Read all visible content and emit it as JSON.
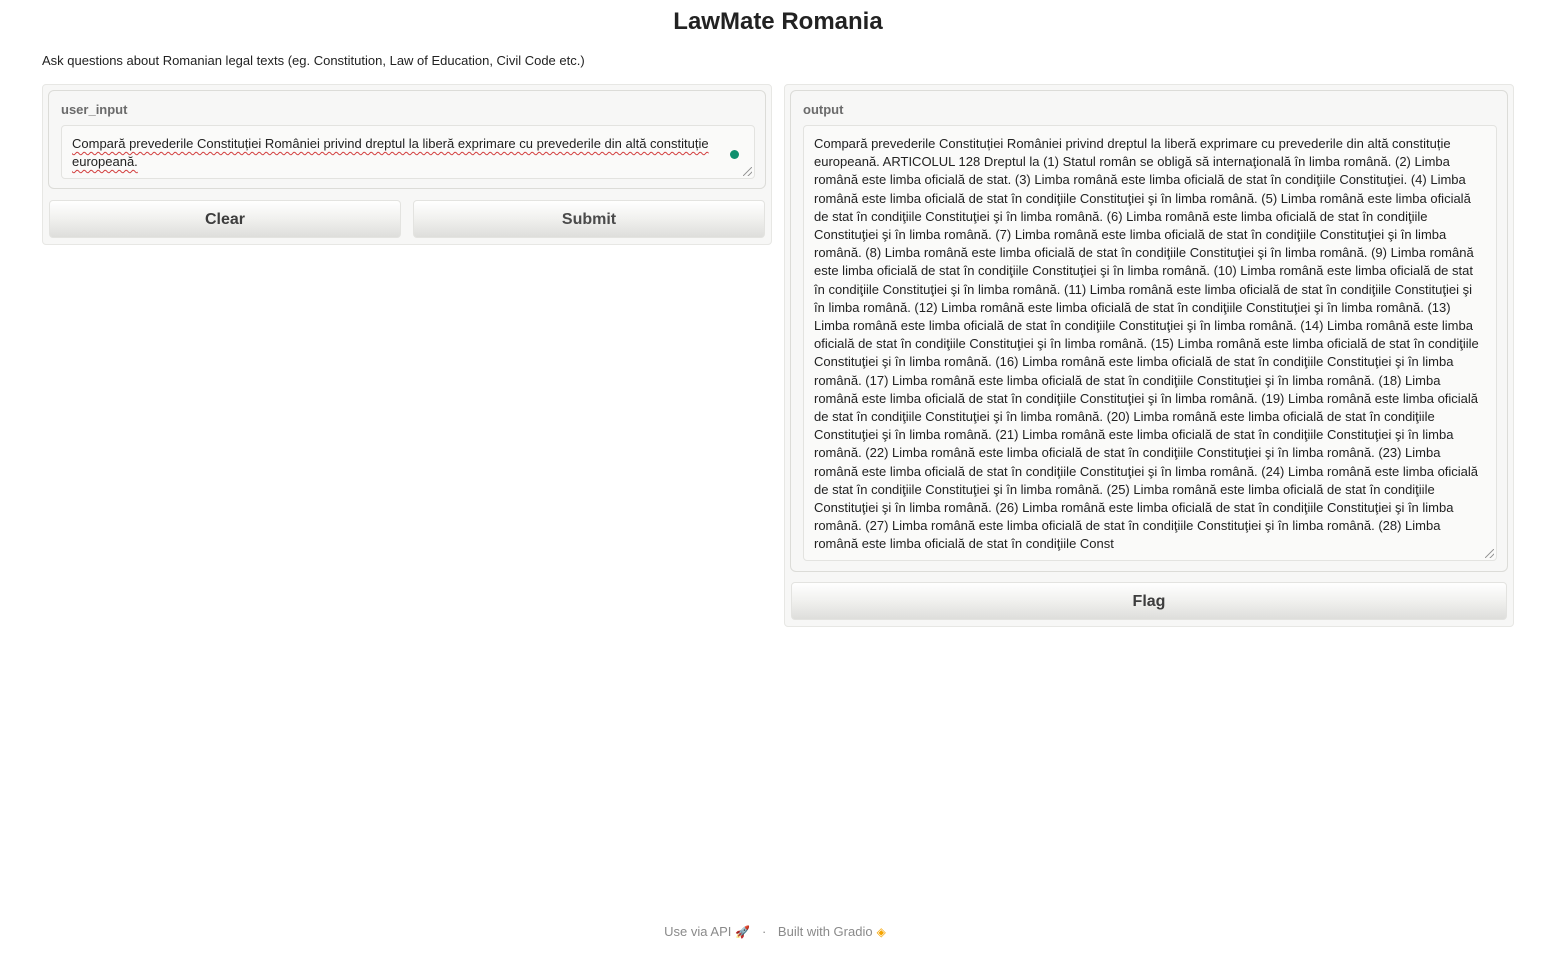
{
  "header": {
    "title": "LawMate Romania",
    "description": "Ask questions about Romanian legal texts (eg. Constitution, Law of Education, Civil Code etc.)"
  },
  "input_panel": {
    "label": "user_input",
    "value": "Compară prevederile Constituției României privind dreptul la liberă exprimare cu prevederile din altă constituție europeană.",
    "clear_label": "Clear",
    "submit_label": "Submit"
  },
  "output_panel": {
    "label": "output",
    "value": "Compară prevederile Constituției României privind dreptul la liberă exprimare cu prevederile din altă constituție europeană. ARTICOLUL 128 Dreptul la (1) Statul român se obligă să internaţională în limba română. (2) Limba română este limba oficială de stat. (3) Limba română este limba oficială de stat în condiţiile Constituţiei. (4) Limba română este limba oficială de stat în condiţiile Constituţiei şi în limba română. (5) Limba română este limba oficială de stat în condiţiile Constituţiei şi în limba română. (6) Limba română este limba oficială de stat în condiţiile Constituţiei şi în limba română. (7) Limba română este limba oficială de stat în condiţiile Constituţiei şi în limba română. (8) Limba română este limba oficială de stat în condiţiile Constituţiei şi în limba română. (9) Limba română este limba oficială de stat în condiţiile Constituţiei şi în limba română. (10) Limba română este limba oficială de stat în condiţiile Constituţiei şi în limba română. (11) Limba română este limba oficială de stat în condiţiile Constituţiei şi în limba română. (12) Limba română este limba oficială de stat în condiţiile Constituţiei şi în limba română. (13) Limba română este limba oficială de stat în condiţiile Constituţiei şi în limba română. (14) Limba română este limba oficială de stat în condiţiile Constituţiei şi în limba română. (15) Limba română este limba oficială de stat în condiţiile Constituţiei şi în limba română. (16) Limba română este limba oficială de stat în condiţiile Constituţiei şi în limba română. (17) Limba română este limba oficială de stat în condiţiile Constituţiei şi în limba română. (18) Limba română este limba oficială de stat în condiţiile Constituţiei şi în limba română. (19) Limba română este limba oficială de stat în condiţiile Constituţiei şi în limba română. (20) Limba română este limba oficială de stat în condiţiile Constituţiei şi în limba română. (21) Limba română este limba oficială de stat în condiţiile Constituţiei şi în limba română. (22) Limba română este limba oficială de stat în condiţiile Constituţiei şi în limba română. (23) Limba română este limba oficială de stat în condiţiile Constituţiei şi în limba română. (24) Limba română este limba oficială de stat în condiţiile Constituţiei şi în limba română. (25) Limba română este limba oficială de stat în condiţiile Constituţiei şi în limba română. (26) Limba română este limba oficială de stat în condiţiile Constituţiei şi în limba română. (27) Limba română este limba oficială de stat în condiţiile Constituţiei şi în limba română. (28) Limba română este limba oficială de stat în condiţiile Const",
    "flag_label": "Flag"
  },
  "footer": {
    "api_label": "Use via API",
    "api_icon": "rocket-icon",
    "separator": "·",
    "built_label": "Built with Gradio",
    "gradio_icon": "gradio-logo-icon"
  }
}
